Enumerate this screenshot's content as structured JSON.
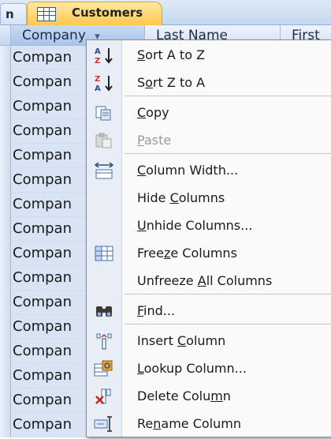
{
  "tabs": {
    "previous_tab_label": "n",
    "active_tab_label": "Customers",
    "active_tab_icon": "table-icon"
  },
  "datasheet": {
    "columns": [
      "Company",
      "Last Name",
      "First"
    ],
    "sort_indicator": "▾",
    "rows": [
      "Compan",
      "Compan",
      "Compan",
      "Compan",
      "Compan",
      "Compan",
      "Compan",
      "Compan",
      "Compan",
      "Compan",
      "Compan",
      "Compan",
      "Compan",
      "Compan",
      "Compan",
      "Compan"
    ]
  },
  "context_menu": {
    "items": [
      {
        "pre": "",
        "key": "S",
        "post": "ort A to Z",
        "icon": "sort-ascending-icon",
        "enabled": true
      },
      {
        "pre": "S",
        "key": "o",
        "post": "rt Z to A",
        "icon": "sort-descending-icon",
        "enabled": true
      },
      {
        "pre": "",
        "key": "C",
        "post": "opy",
        "icon": "copy-icon",
        "enabled": true
      },
      {
        "pre": "",
        "key": "P",
        "post": "aste",
        "icon": "paste-icon",
        "enabled": false
      },
      {
        "pre": "",
        "key": "C",
        "post": "olumn Width...",
        "icon": "column-width-icon",
        "enabled": true
      },
      {
        "pre": "Hide ",
        "key": "C",
        "post": "olumns",
        "icon": "",
        "enabled": true
      },
      {
        "pre": "",
        "key": "U",
        "post": "nhide Columns...",
        "icon": "",
        "enabled": true
      },
      {
        "pre": "Free",
        "key": "z",
        "post": "e Columns",
        "icon": "freeze-columns-icon",
        "enabled": true
      },
      {
        "pre": "Unfreeze ",
        "key": "A",
        "post": "ll Columns",
        "icon": "",
        "enabled": true
      },
      {
        "pre": "",
        "key": "F",
        "post": "ind...",
        "icon": "binoculars-icon",
        "enabled": true
      },
      {
        "pre": "Insert ",
        "key": "C",
        "post": "olumn",
        "icon": "insert-column-icon",
        "enabled": true
      },
      {
        "pre": "",
        "key": "L",
        "post": "ookup Column...",
        "icon": "lookup-column-icon",
        "enabled": true
      },
      {
        "pre": "Delete Colu",
        "key": "m",
        "post": "n",
        "icon": "delete-column-icon",
        "enabled": true
      },
      {
        "pre": "Re",
        "key": "n",
        "post": "ame Column",
        "icon": "rename-column-icon",
        "enabled": true
      }
    ]
  },
  "colors": {
    "active_tab": "#ffc94c",
    "header_selected": "#a9c4ea",
    "cell_selected": "#d8e4f4",
    "menu_background": "#fafafa",
    "menu_gutter": "#e9eef6"
  }
}
